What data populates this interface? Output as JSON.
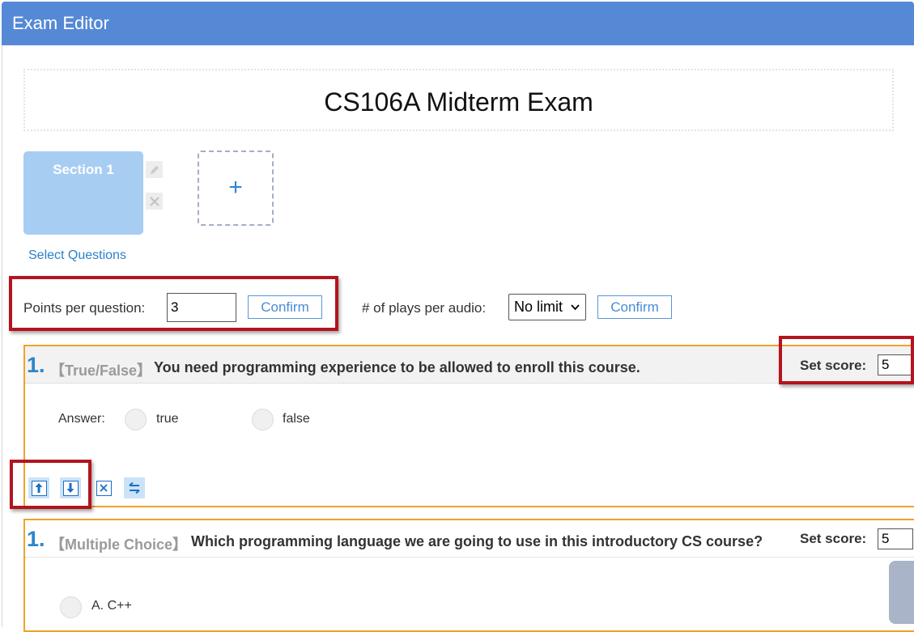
{
  "app": {
    "title": "Exam Editor"
  },
  "exam": {
    "title": "CS106A Midterm Exam"
  },
  "sections": {
    "items": [
      {
        "label": "Section 1"
      }
    ],
    "add_label": "+",
    "select_questions_link": "Select Questions",
    "edit_icon": "pencil-icon",
    "delete_icon": "close-icon"
  },
  "settings": {
    "points_label": "Points per question:",
    "points_value": "3",
    "confirm_label": "Confirm",
    "plays_label": "# of plays per audio:",
    "plays_value": "No limit",
    "plays_confirm_label": "Confirm"
  },
  "questions": [
    {
      "number": "1.",
      "type": "【True/False】",
      "text": "You need programming experience to be allowed to enroll this course.",
      "score_label": "Set score:",
      "score_value": "5",
      "answer_label": "Answer:",
      "options": [
        "true",
        "false"
      ],
      "tools": [
        "move-up-icon",
        "move-down-icon",
        "delete-icon",
        "swap-icon"
      ]
    },
    {
      "number": "1.",
      "type": "【Multiple Choice】",
      "text": "Which programming language we are going to use in this introductory CS course?",
      "score_label": "Set score:",
      "score_value": "5",
      "options": [
        "A. C++"
      ]
    }
  ],
  "colors": {
    "header": "#5589d6",
    "accent": "#2b86cc",
    "highlight": "#b3141e",
    "card_border": "#f0a22a",
    "section": "#a8cdf3"
  }
}
